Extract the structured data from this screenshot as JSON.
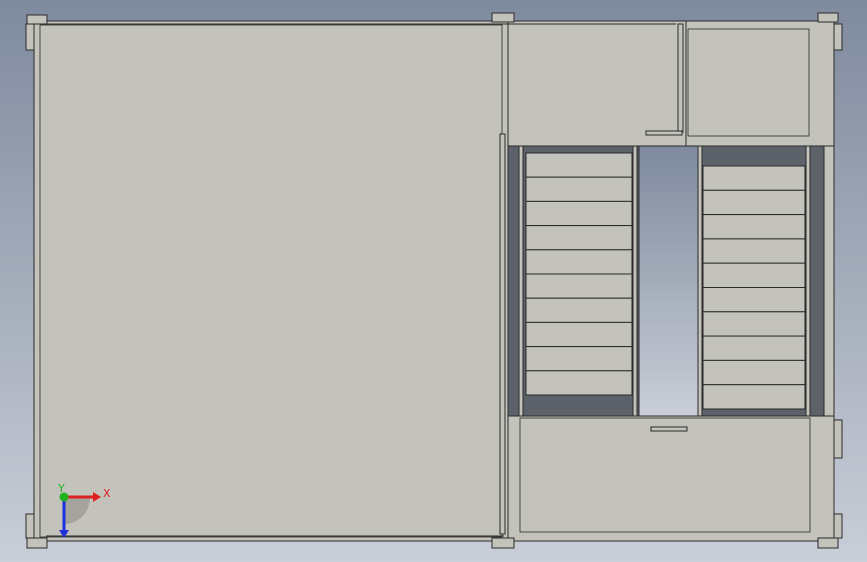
{
  "viewport": {
    "background_top": "#7f8a9e",
    "background_bottom": "#c9ced7",
    "floor_color": "#c3c3bb",
    "line_color": "#2a2a2a",
    "stair_well_color": "#5c616a"
  },
  "stairs": {
    "left_flight_treads": 10,
    "right_flight_treads": 10
  },
  "triad": {
    "x_label": "X",
    "y_label": "Y",
    "x_color": "#e02020",
    "y_color": "#1fb31f",
    "z_color": "#2030d8"
  }
}
